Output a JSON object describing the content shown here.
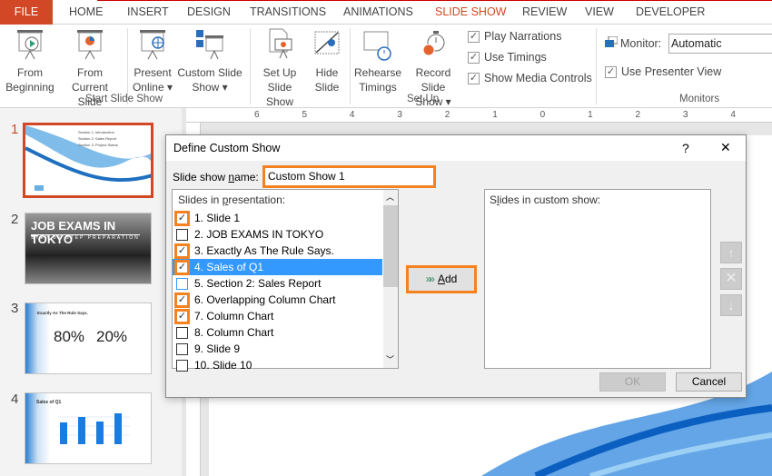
{
  "tabs": [
    "FILE",
    "HOME",
    "INSERT",
    "DESIGN",
    "TRANSITIONS",
    "ANIMATIONS",
    "SLIDE SHOW",
    "REVIEW",
    "VIEW",
    "DEVELOPER"
  ],
  "ribbon": {
    "from_beginning": [
      "From",
      "Beginning"
    ],
    "from_current": [
      "From",
      "Current Slide"
    ],
    "present_online": [
      "Present",
      "Online ▾"
    ],
    "custom_slide_show": [
      "Custom Slide",
      "Show ▾"
    ],
    "group_start": "Start Slide Show",
    "setup_show": [
      "Set Up",
      "Slide Show"
    ],
    "hide_slide": [
      "Hide",
      "Slide"
    ],
    "rehearse": [
      "Rehearse",
      "Timings"
    ],
    "record": [
      "Record Slide",
      "Show ▾"
    ],
    "play_narrations": "Play Narrations",
    "use_timings": "Use Timings",
    "show_media_controls": "Show Media Controls",
    "group_setup": "Set Up",
    "monitor_label": "Monitor:",
    "monitor_value": "Automatic",
    "presenter_view": "Use Presenter View",
    "group_monitors": "Monitors"
  },
  "ruler_numbers": [
    "6",
    "5",
    "4",
    "3",
    "2",
    "1",
    "0",
    "1",
    "2",
    "3",
    "4"
  ],
  "thumbnails": [
    {
      "num": "1",
      "lines": [
        "Section 1: Introduction",
        "Section 2: Sales Report",
        "Section 3: Project Status"
      ]
    },
    {
      "num": "2",
      "title": "JOB EXAMS IN TOKYO",
      "subtitle": "STEP BY STEP PREPARATION"
    },
    {
      "num": "3",
      "title": "Exactly As The Rule Says.",
      "v1": "80%",
      "v2": "20%"
    },
    {
      "num": "4",
      "title": "Sales of Q1"
    }
  ],
  "dialog": {
    "title": "Define Custom Show",
    "help": "?",
    "close": "✕",
    "name_label_pre": "Slide show ",
    "name_label_u": "n",
    "name_label_post": "ame:",
    "name_value": "Custom Show 1",
    "left_header_pre": "Slides in ",
    "left_header_u": "p",
    "left_header_post": "resentation:",
    "slides": [
      {
        "label": "1. Slide 1",
        "checked": true
      },
      {
        "label": "2. JOB EXAMS IN TOKYO",
        "checked": false
      },
      {
        "label": "3. Exactly As The Rule Says.",
        "checked": true
      },
      {
        "label": "4. Sales of Q1",
        "checked": true
      },
      {
        "label": "5. Section 2: Sales Report",
        "checked": false
      },
      {
        "label": "6. Overlapping Column Chart",
        "checked": true
      },
      {
        "label": "7. Column Chart",
        "checked": true
      },
      {
        "label": "8. Column Chart",
        "checked": false
      },
      {
        "label": "9. Slide 9",
        "checked": false
      },
      {
        "label": "10. Slide 10",
        "checked": false
      }
    ],
    "add_u": "A",
    "add_rest": "dd",
    "right_header_pre": "S",
    "right_header_u": "l",
    "right_header_post": "ides in custom show:",
    "ok": "OK",
    "cancel": "Cancel"
  },
  "colors": {
    "accent": "#d24726",
    "highlight": "#f58220",
    "selection": "#3399ff"
  }
}
